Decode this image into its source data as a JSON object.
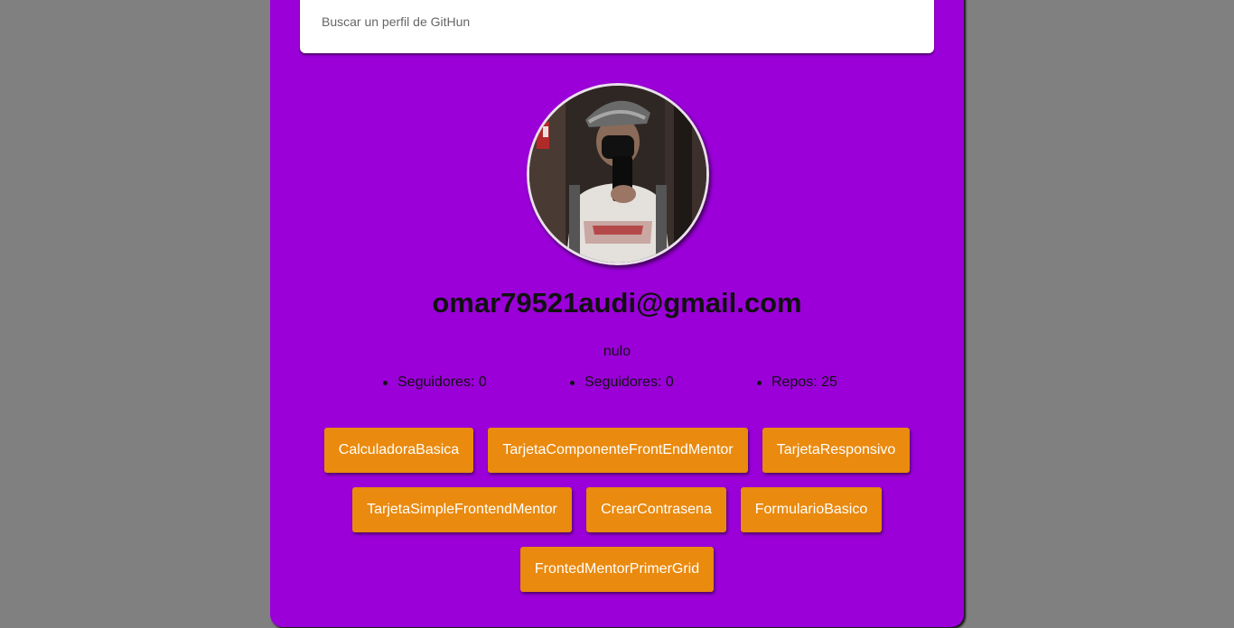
{
  "search": {
    "placeholder": "Buscar un perfil de GitHun",
    "value": ""
  },
  "profile": {
    "name": "omar79521audi@gmail.com",
    "bio": "nulo",
    "stats": [
      {
        "label": "Seguidores: 0"
      },
      {
        "label": "Seguidores: 0"
      },
      {
        "label": "Repos: 25"
      }
    ]
  },
  "repos": [
    {
      "label": "CalculadoraBasica"
    },
    {
      "label": "TarjetaComponenteFrontEndMentor"
    },
    {
      "label": "TarjetaResponsivo"
    },
    {
      "label": "TarjetaSimpleFrontendMentor"
    },
    {
      "label": "CrearContrasena"
    },
    {
      "label": "FormularioBasico"
    },
    {
      "label": "FrontedMentorPrimerGrid"
    }
  ],
  "colors": {
    "background": "#808080",
    "card": "#9b00d9",
    "repo_button": "#ea8a0e",
    "text": "#111111"
  }
}
